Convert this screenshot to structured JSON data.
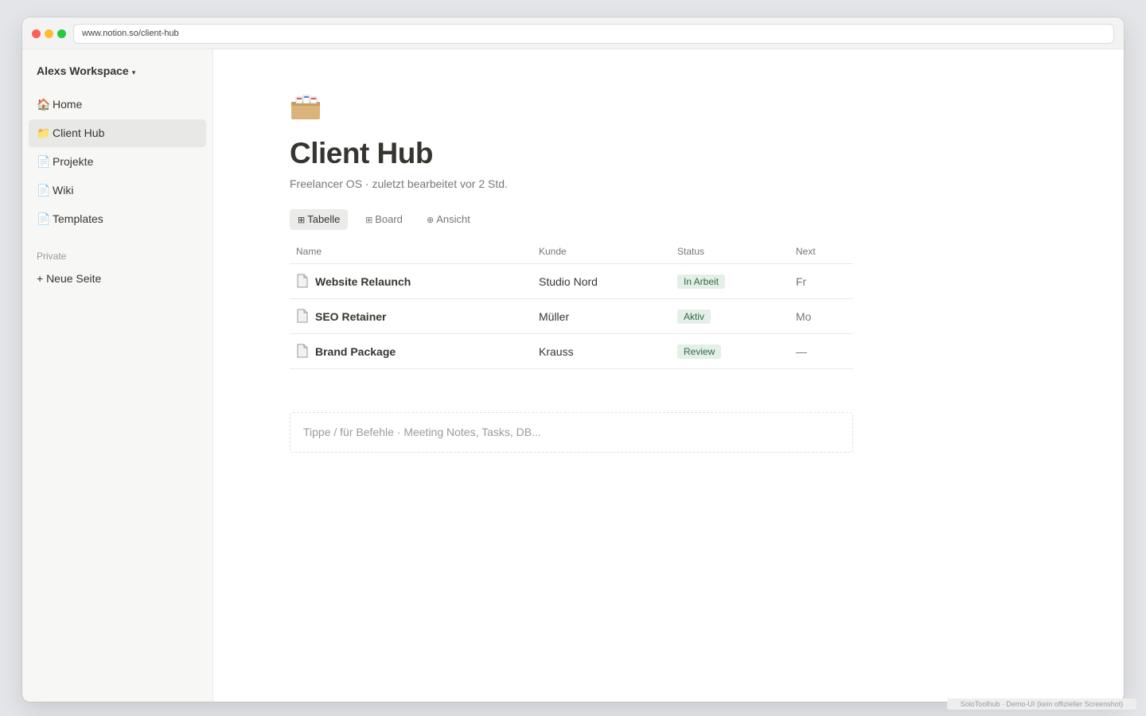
{
  "browser": {
    "url": "www.notion.so/client-hub"
  },
  "sidebar": {
    "workspace_name": "Alexs Workspace",
    "workspace_caret": "▾",
    "items": [
      {
        "icon": "🏠",
        "icon_name": "house-icon",
        "label": "Home"
      },
      {
        "icon": "📁",
        "icon_name": "folder-icon",
        "label": "Client Hub",
        "active": true
      },
      {
        "icon": "📄",
        "icon_name": "page-icon",
        "label": "Projekte"
      },
      {
        "icon": "📄",
        "icon_name": "page-icon",
        "label": "Wiki"
      },
      {
        "icon": "📄",
        "icon_name": "page-icon",
        "label": "Templates"
      }
    ],
    "section_label": "Private",
    "new_page_label": "+ Neue Seite"
  },
  "page": {
    "icon_name": "card-index-box-icon",
    "title": "Client Hub",
    "subtitle": "Freelancer OS · zuletzt bearbeitet vor 2 Std.",
    "view_tabs": [
      {
        "icon": "⊞",
        "label": "Tabelle",
        "active": true
      },
      {
        "icon": "⊞",
        "label": "Board"
      },
      {
        "icon": "⊕",
        "label": "Ansicht"
      }
    ],
    "table": {
      "columns": [
        "Name",
        "Kunde",
        "Status",
        "Next"
      ],
      "rows": [
        {
          "name": "Website Relaunch",
          "kunde": "Studio Nord",
          "status": "In Arbeit",
          "next": "Fr"
        },
        {
          "name": "SEO Retainer",
          "kunde": "Müller",
          "status": "Aktiv",
          "next": "Mo"
        },
        {
          "name": "Brand Package",
          "kunde": "Krauss",
          "status": "Review",
          "next": "—"
        }
      ]
    },
    "command_placeholder": "Tippe / für Befehle · Meeting Notes, Tasks, DB..."
  },
  "footnote": "SoloToolhub · Demo-UI (kein offizieller Screenshot)",
  "colors": {
    "sidebar_bg": "#f7f7f5",
    "text": "#37352f",
    "muted": "#787774",
    "status_badge_bg": "#e4efe8",
    "status_badge_text": "#2f6b46"
  }
}
